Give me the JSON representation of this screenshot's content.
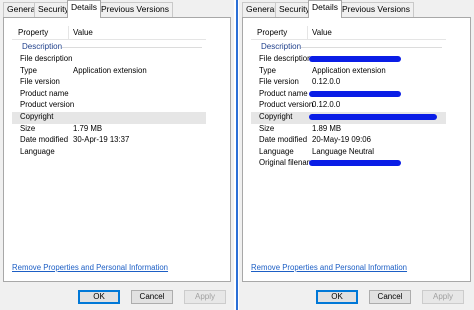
{
  "tabs": [
    "General",
    "Security",
    "Details",
    "Previous Versions"
  ],
  "active_tab": "Details",
  "columns": {
    "property": "Property",
    "value": "Value"
  },
  "section_title": "Description",
  "left": {
    "rows": [
      {
        "key": "File description",
        "value": ""
      },
      {
        "key": "Type",
        "value": "Application extension"
      },
      {
        "key": "File version",
        "value": ""
      },
      {
        "key": "Product name",
        "value": ""
      },
      {
        "key": "Product version",
        "value": ""
      },
      {
        "key": "Copyright",
        "value": ""
      },
      {
        "key": "Size",
        "value": "1.79 MB"
      },
      {
        "key": "Date modified",
        "value": "30-Apr-19 13:37"
      },
      {
        "key": "Language",
        "value": ""
      }
    ]
  },
  "right": {
    "rows": [
      {
        "key": "File description",
        "value": "",
        "redacted": true
      },
      {
        "key": "Type",
        "value": "Application extension"
      },
      {
        "key": "File version",
        "value": "0.12.0.0"
      },
      {
        "key": "Product name",
        "value": "",
        "redacted": true
      },
      {
        "key": "Product version",
        "value": "0.12.0.0"
      },
      {
        "key": "Copyright",
        "value": "",
        "redacted": true
      },
      {
        "key": "Size",
        "value": "1.89 MB"
      },
      {
        "key": "Date modified",
        "value": "20-May-19 09:06"
      },
      {
        "key": "Language",
        "value": "Language Neutral"
      },
      {
        "key": "Original filename",
        "value": "",
        "redacted": true
      }
    ]
  },
  "link_text": "Remove Properties and Personal Information",
  "buttons": {
    "ok": "OK",
    "cancel": "Cancel",
    "apply": "Apply"
  },
  "colors": {
    "redaction": "#0a1de6",
    "link": "#1d5fc5",
    "section": "#1e3f8b",
    "divider": "#2b6fd6"
  }
}
